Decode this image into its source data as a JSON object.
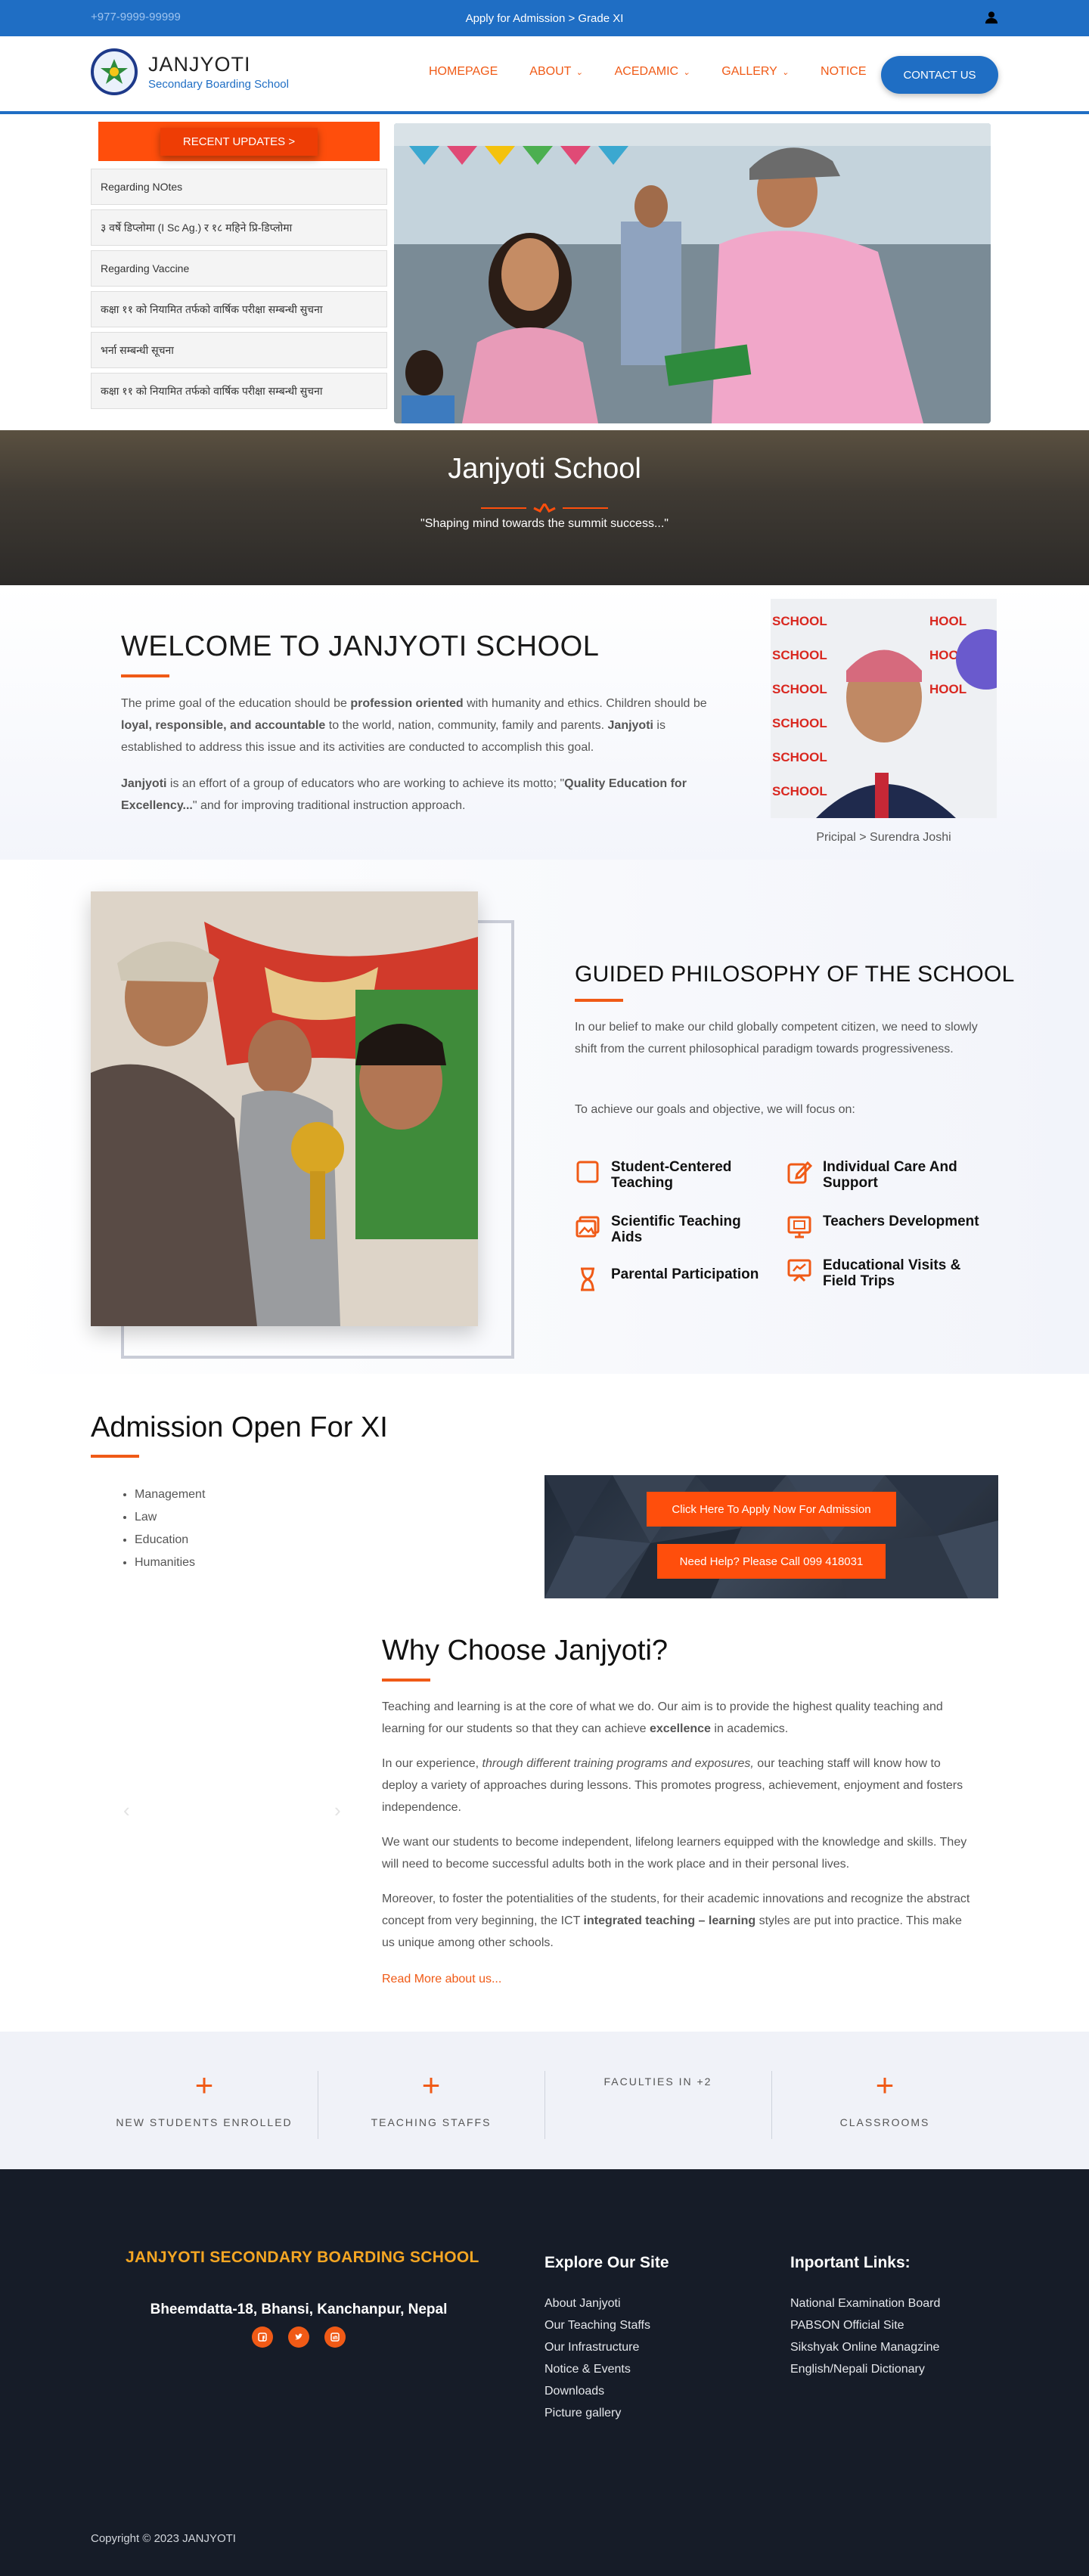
{
  "topbar": {
    "phone": "+977-9999-99999",
    "admission": "Apply for Admission > Grade XI"
  },
  "header": {
    "logo_title": "JANJYOTI",
    "logo_sub": "Secondary Boarding School",
    "nav": [
      "HOMEPAGE",
      "ABOUT",
      "ACEDAMIC",
      "GALLERY",
      "NOTICE"
    ],
    "contact": "CONTACT US"
  },
  "updates": {
    "button": "RECENT UPDATES >",
    "items": [
      "Regarding NOtes",
      "३ वर्षे डिप्लोमा (I Sc Ag.) र १८ महिने प्रि-डिप्लोमा",
      "Regarding Vaccine",
      "कक्षा ११ को नियामित तर्फको वार्षिक परीक्षा सम्बन्धी सुचना",
      "भर्ना सम्बन्धी सूचना",
      "कक्षा ११ को नियामित तर्फको वार्षिक परीक्षा सम्बन्धी सुचना"
    ]
  },
  "banner": {
    "title": "Janjyoti School",
    "tagline": "\"Shaping mind towards the summit success...\""
  },
  "welcome": {
    "title": "WELCOME TO JANJYOTI SCHOOL",
    "p1a": "The prime goal of the education should be ",
    "p1b": "profession oriented",
    "p1c": " with humanity and ethics. Children should be ",
    "p1d": "loyal, responsible, and accountable",
    "p1e": " to the world, nation, community, family and parents. ",
    "p1f": "Janjyoti",
    "p1g": " is established to address this issue and its activities are conducted to accomplish this goal.",
    "p2a": "Janjyoti",
    "p2b": " is an effort of a group of educators who are working to achieve its motto; \"",
    "p2c": "Quality Education for Excellency...",
    "p2d": "\" and for improving traditional instruction approach.",
    "principal_caption": "Pricipal > Surendra Joshi"
  },
  "philosophy": {
    "title": "GUIDED PHILOSOPHY OF THE SCHOOL",
    "p1": "In our belief to make our child globally competent citizen, we need to slowly shift from the current  philosophical  paradigm  towards progressiveness.",
    "p2": "To achieve our goals and objective, we will focus on:",
    "features": [
      {
        "label": "Student-Centered Teaching",
        "icon": "square-icon"
      },
      {
        "label": "Individual Care And Support",
        "icon": "edit-icon"
      },
      {
        "label": "Scientific Teaching Aids",
        "icon": "images-icon"
      },
      {
        "label": "Teachers Development",
        "icon": "screen-icon"
      },
      {
        "label": "Parental Participation",
        "icon": "hourglass-icon"
      },
      {
        "label": "Educational Visits & Field Trips",
        "icon": "presentation-icon"
      }
    ]
  },
  "admission": {
    "title": "Admission Open For XI",
    "streams": [
      "Management",
      "Law",
      "Education",
      "Humanities"
    ],
    "apply": "Click Here To Apply Now For Admission",
    "help": "Need Help? Please Call 099 418031"
  },
  "why": {
    "title": "Why Choose Janjyoti?",
    "p1a": "Teaching and learning is at the core of what we do. Our aim is to provide the highest quality teaching and learning for our students so that they can achieve ",
    "p1b": "excellence",
    "p1c": " in academics.",
    "p2a": "In our experience, ",
    "p2b": "through different training programs and exposures,",
    "p2c": " our teaching staff will know how to deploy a variety of approaches during lessons. This promotes progress, achievement, enjoyment and fosters independence.",
    "p3": "We want our students to become independent, lifelong learners equipped with the knowledge and skills. They will need to become successful adults both in the work place and in their personal lives.",
    "p4a": "Moreover, to foster the potentialities of the students, for their academic innovations and recognize the abstract concept from very beginning, the ICT ",
    "p4b": "integrated teaching – learning",
    "p4c": " styles are put into practice. This make us unique among other schools.",
    "more": "Read More about us..."
  },
  "stats": [
    {
      "label": "NEW STUDENTS ENROLLED",
      "value": "+"
    },
    {
      "label": "TEACHING STAFFS",
      "value": "+"
    },
    {
      "label": "FACULTIES IN +2",
      "value": ""
    },
    {
      "label": "CLASSROOMS",
      "value": "+"
    }
  ],
  "footer": {
    "school": "JANJYOTI SECONDARY BOARDING SCHOOL",
    "address": "Bheemdatta-18, Bhansi, Kanchanpur, Nepal",
    "explore_title": "Explore Our Site",
    "explore": [
      "About Janjyoti",
      "Our Teaching Staffs",
      "Our Infrastructure",
      "Notice & Events",
      "Downloads",
      "Picture gallery"
    ],
    "links_title": "Inportant Links:",
    "links": [
      "National Examination Board",
      "PABSON Official Site",
      "Sikshyak Online Managzine",
      "English/Nepali Dictionary"
    ],
    "copyright": "Copyright © 2023 JANJYOTI"
  },
  "colors": {
    "primary": "#1f6ec4",
    "accent": "#f05a16",
    "footer": "#161c28"
  }
}
